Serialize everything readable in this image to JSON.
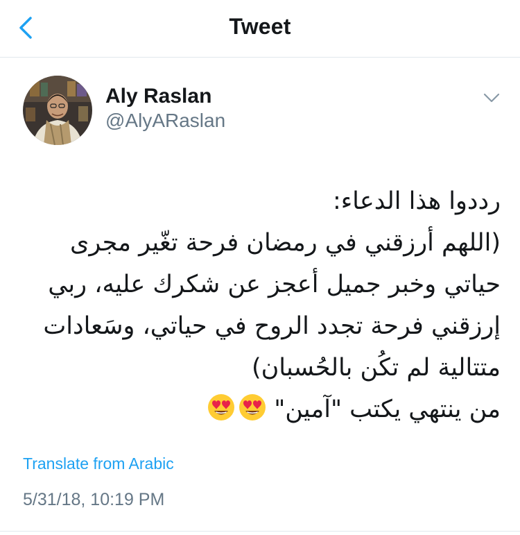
{
  "header": {
    "title": "Tweet",
    "back_icon": "chevron-left-icon",
    "accent": "#1da1f2"
  },
  "tweet": {
    "author_name": "Aly Raslan",
    "author_handle": "@AlyARaslan",
    "menu_icon": "chevron-down-icon",
    "lines": [
      "رددوا هذا الدعاء:",
      "(اللهم أرزقني في رمضان فرحة تغّير مجرى",
      "حياتي وخبر جميل أعجز عن شكرك عليه، ربي",
      "إرزقني فرحة تجدد الروح في حياتي، وسَعادات",
      "متتالية لم تكُن بالحُسبان)",
      "من ينتهي يكتب \"آمين\""
    ],
    "emoji": [
      "heart-eyes-emoji",
      "heart-eyes-emoji"
    ],
    "translate_label": "Translate from Arabic",
    "timestamp": "5/31/18, 10:19 PM"
  },
  "colors": {
    "text": "#14171a",
    "secondary": "#657786",
    "link": "#1da1f2",
    "divider": "#e1e8ed"
  }
}
